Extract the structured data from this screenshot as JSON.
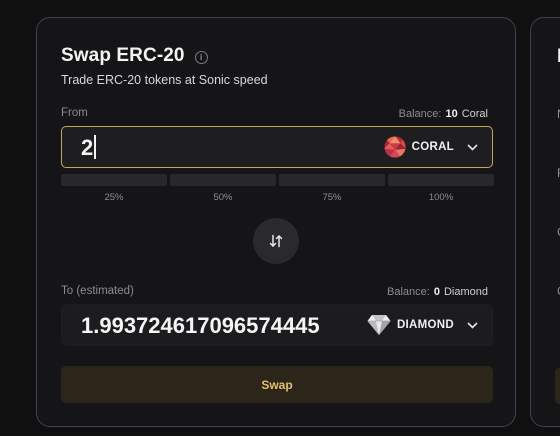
{
  "swap": {
    "title": "Swap ERC-20",
    "info_glyph": "i",
    "subtitle": "Trade ERC-20 tokens at Sonic speed",
    "from": {
      "label": "From",
      "balance_label": "Balance:",
      "balance_value": "10",
      "balance_token": "Coral",
      "amount": "2",
      "token": "CORAL",
      "token_icon": "coral-token-icon",
      "focused": true
    },
    "percentages": [
      "25%",
      "50%",
      "75%",
      "100%"
    ],
    "direction_icon": "swap-arrows-icon",
    "to": {
      "label": "To (estimated)",
      "balance_label": "Balance:",
      "balance_value": "0",
      "balance_token": "Diamond",
      "amount": "1.99372461709657 4445",
      "token": "DIAMOND",
      "token_icon": "diamond-token-icon"
    },
    "submit_label": "Swap"
  },
  "side_panel": {
    "heading_letter": "M",
    "row_letters": [
      "N",
      "F",
      "C",
      "C"
    ]
  },
  "colors": {
    "accent": "#c9a659",
    "swap_button_bg": "#2b251a",
    "swap_button_text": "#e8c069",
    "card_border": "#3d4452"
  }
}
